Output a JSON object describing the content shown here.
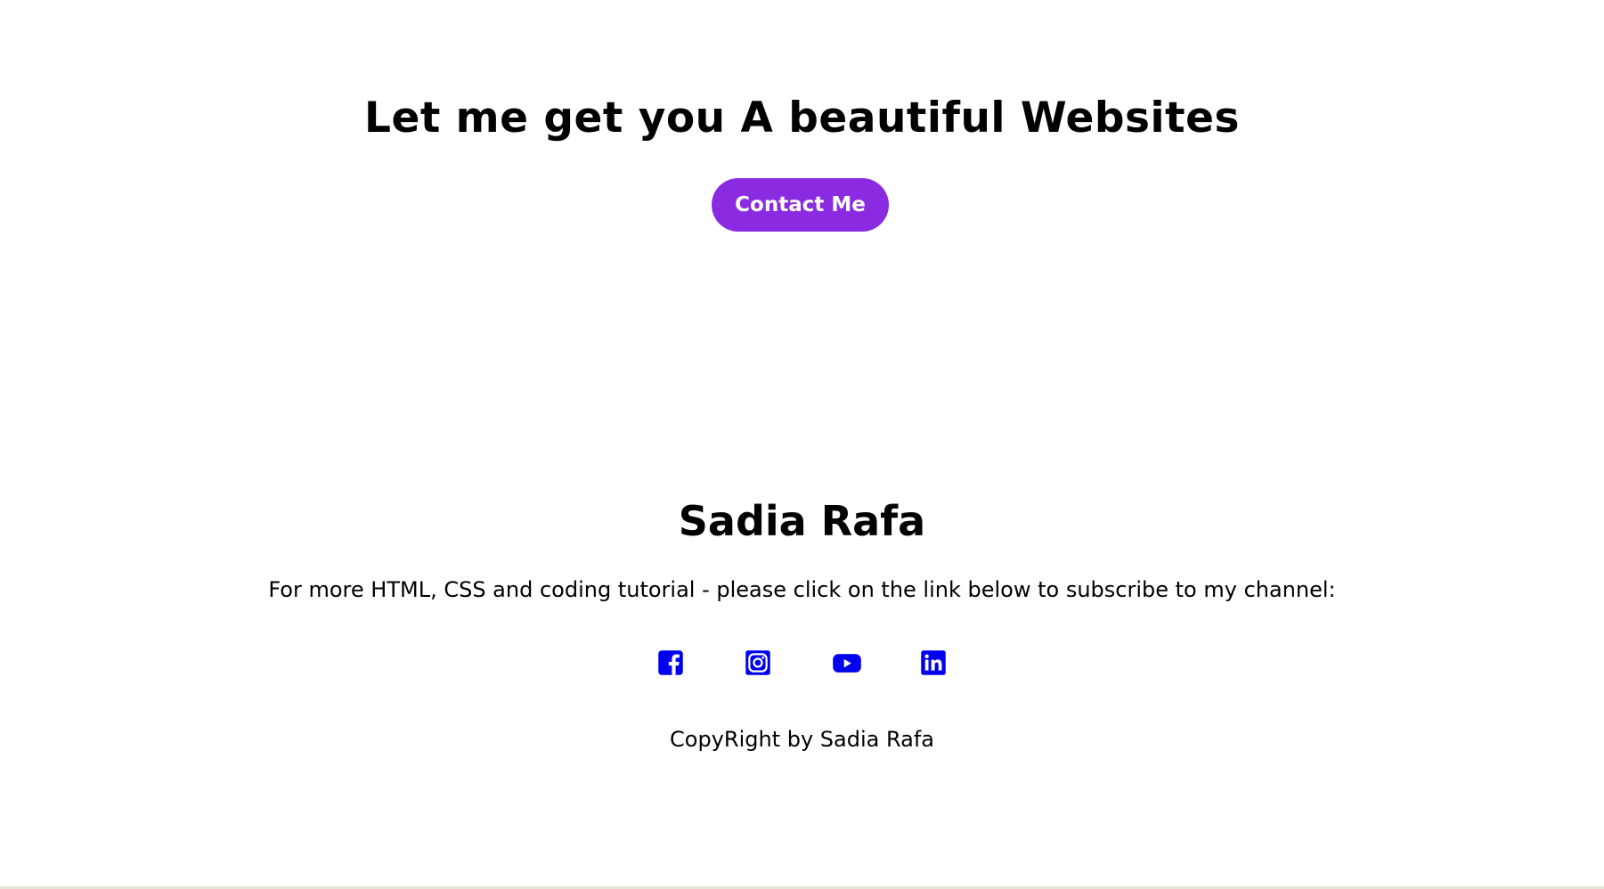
{
  "hero": {
    "title": "Let me get you A beautiful Websites",
    "contact_label": "Contact Me"
  },
  "footer": {
    "name": "Sadia Rafa",
    "tagline": "For more HTML, CSS and coding tutorial - please click on the link below to subscribe to my channel:",
    "copyright": "CopyRight by Sadia Rafa",
    "social": [
      {
        "icon": "facebook-icon"
      },
      {
        "icon": "instagram-icon"
      },
      {
        "icon": "youtube-icon"
      },
      {
        "icon": "linkedin-icon"
      }
    ]
  },
  "colors": {
    "accent": "#8a2be2",
    "icon": "#0000ee",
    "text": "#000000",
    "background": "#ffffff"
  }
}
